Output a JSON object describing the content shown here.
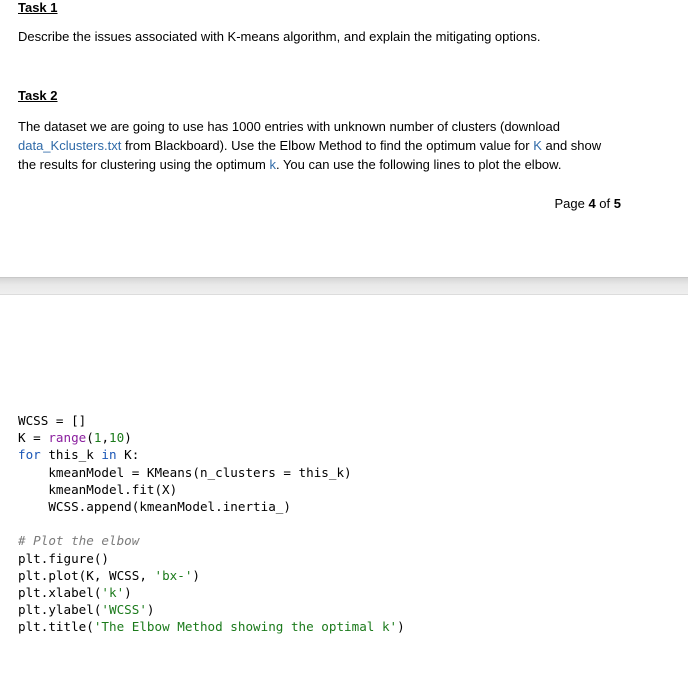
{
  "task1": {
    "heading": "Task 1",
    "text": "Describe the issues associated with K-means algorithm, and explain the mitigating options."
  },
  "task2": {
    "heading": "Task 2",
    "text_1": "The dataset we are going to use has 1000 entries with unknown number of clusters (download",
    "file_name": "data_Kclusters.txt",
    "text_2": " from Blackboard). Use the Elbow Method to find the optimum value for ",
    "k_upper": "K",
    "text_3": " and show",
    "text_4": "the results for clustering using the optimum ",
    "k_lower": "k",
    "text_5": ". You can use the following lines to plot the elbow."
  },
  "page_footer": {
    "prefix": "Page ",
    "current": "4",
    "middle": " of ",
    "total": "5"
  },
  "code": {
    "l1_a": "WCSS = []",
    "l2_a": "K = ",
    "l2_fn": "range",
    "l2_b": "(",
    "l2_n1": "1",
    "l2_c": ",",
    "l2_n2": "10",
    "l2_d": ")",
    "l3_kw1": "for",
    "l3_a": " this_k ",
    "l3_kw2": "in",
    "l3_b": " K:",
    "l4": "    kmeanModel = KMeans(n_clusters = this_k)",
    "l5": "    kmeanModel.fit(X)",
    "l6": "    WCSS.append(kmeanModel.inertia_)",
    "l8_comment": "# Plot the elbow",
    "l9": "plt.figure()",
    "l10_a": "plt.plot(K, WCSS, ",
    "l10_s": "'bx-'",
    "l10_b": ")",
    "l11_a": "plt.xlabel(",
    "l11_s": "'k'",
    "l11_b": ")",
    "l12_a": "plt.ylabel(",
    "l12_s": "'WCSS'",
    "l12_b": ")",
    "l13_a": "plt.title(",
    "l13_s": "'The Elbow Method showing the optimal k'",
    "l13_b": ")"
  }
}
